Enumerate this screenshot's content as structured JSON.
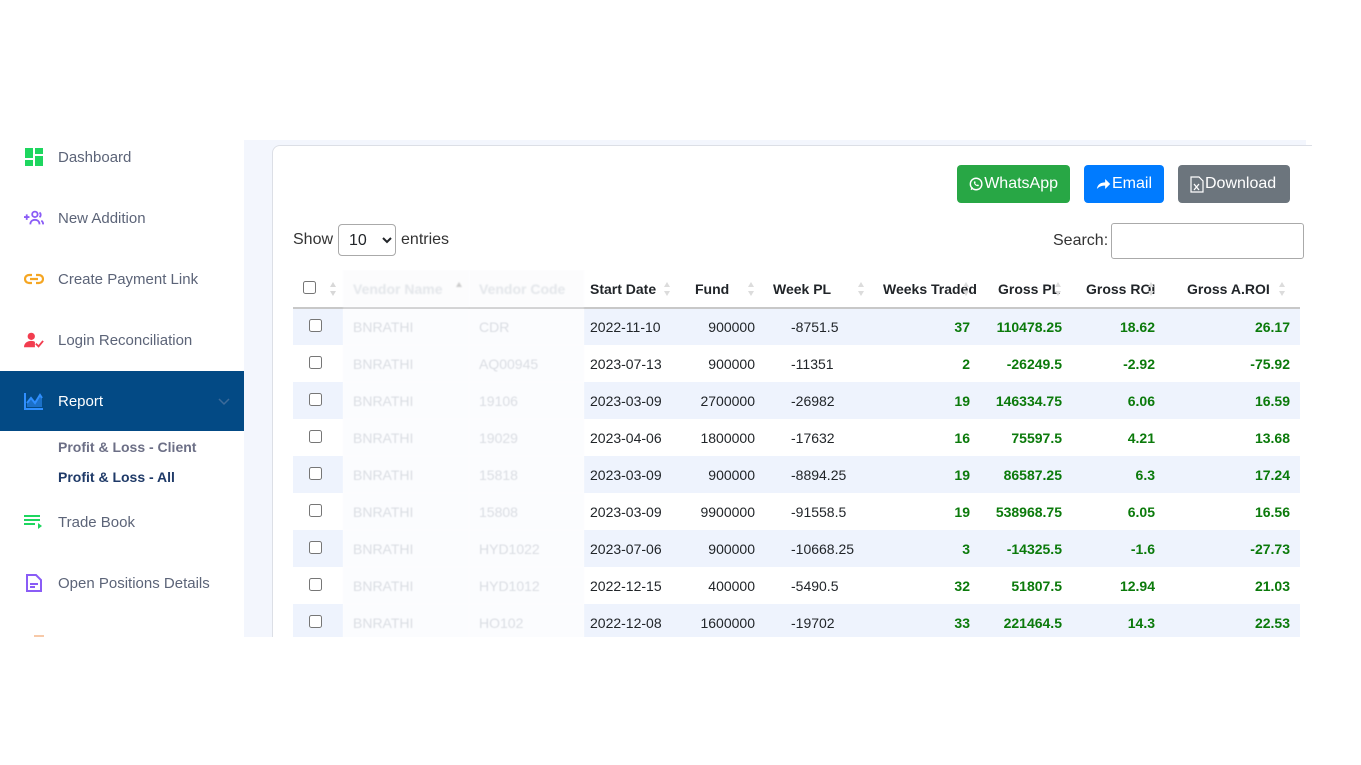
{
  "sidebar": {
    "items": [
      {
        "label": "Dashboard",
        "icon": "dashboard-icon",
        "color": "#1ed65f"
      },
      {
        "label": "New Addition",
        "icon": "add-users-icon",
        "color": "#8a5cf6"
      },
      {
        "label": "Create Payment Link",
        "icon": "link-icon",
        "color": "#f5a623"
      },
      {
        "label": "Login Reconciliation",
        "icon": "user-check-icon",
        "color": "#f23d4f"
      },
      {
        "label": "Report",
        "icon": "chart-line-icon",
        "color": "#2f8fff",
        "active": true
      },
      {
        "label": "Trade Book",
        "icon": "list-play-icon",
        "color": "#1ed65f"
      },
      {
        "label": "Open Positions Details",
        "icon": "document-icon",
        "color": "#8a5cf6"
      }
    ],
    "report_submenu": [
      {
        "label": "Profit & Loss - Client"
      },
      {
        "label": "Profit & Loss - All",
        "active": true
      }
    ]
  },
  "toolbar": {
    "whatsapp_label": "WhatsApp",
    "email_label": "Email",
    "download_label": "Download",
    "colors": {
      "whatsapp": "#28a745",
      "email": "#007bff",
      "download": "#6c757d"
    }
  },
  "length_menu": {
    "show_label": "Show",
    "entries_label": "entries",
    "selected": "10",
    "options": [
      "10"
    ]
  },
  "search": {
    "label": "Search:",
    "value": ""
  },
  "table": {
    "columns": [
      "Vendor Name",
      "Vendor Code",
      "Start Date",
      "Fund",
      "Week PL",
      "Weeks Traded",
      "Gross PL",
      "Gross ROI",
      "Gross A.ROI"
    ],
    "rows": [
      {
        "vendor_name": "BNRATHI",
        "vendor_code": "CDR",
        "start_date": "2022-11-10",
        "fund": "900000",
        "week_pl": "-8751.5",
        "weeks_traded": "37",
        "gross_pl": "110478.25",
        "gross_roi": "18.62",
        "gross_aroi": "26.17"
      },
      {
        "vendor_name": "BNRATHI",
        "vendor_code": "AQ00945",
        "start_date": "2023-07-13",
        "fund": "900000",
        "week_pl": "-11351",
        "weeks_traded": "2",
        "gross_pl": "-26249.5",
        "gross_roi": "-2.92",
        "gross_aroi": "-75.92"
      },
      {
        "vendor_name": "BNRATHI",
        "vendor_code": "19106",
        "start_date": "2023-03-09",
        "fund": "2700000",
        "week_pl": "-26982",
        "weeks_traded": "19",
        "gross_pl": "146334.75",
        "gross_roi": "6.06",
        "gross_aroi": "16.59"
      },
      {
        "vendor_name": "BNRATHI",
        "vendor_code": "19029",
        "start_date": "2023-04-06",
        "fund": "1800000",
        "week_pl": "-17632",
        "weeks_traded": "16",
        "gross_pl": "75597.5",
        "gross_roi": "4.21",
        "gross_aroi": "13.68"
      },
      {
        "vendor_name": "BNRATHI",
        "vendor_code": "15818",
        "start_date": "2023-03-09",
        "fund": "900000",
        "week_pl": "-8894.25",
        "weeks_traded": "19",
        "gross_pl": "86587.25",
        "gross_roi": "6.3",
        "gross_aroi": "17.24"
      },
      {
        "vendor_name": "BNRATHI",
        "vendor_code": "15808",
        "start_date": "2023-03-09",
        "fund": "9900000",
        "week_pl": "-91558.5",
        "weeks_traded": "19",
        "gross_pl": "538968.75",
        "gross_roi": "6.05",
        "gross_aroi": "16.56"
      },
      {
        "vendor_name": "BNRATHI",
        "vendor_code": "HYD1022",
        "start_date": "2023-07-06",
        "fund": "900000",
        "week_pl": "-10668.25",
        "weeks_traded": "3",
        "gross_pl": "-14325.5",
        "gross_roi": "-1.6",
        "gross_aroi": "-27.73"
      },
      {
        "vendor_name": "BNRATHI",
        "vendor_code": "HYD1012",
        "start_date": "2022-12-15",
        "fund": "400000",
        "week_pl": "-5490.5",
        "weeks_traded": "32",
        "gross_pl": "51807.5",
        "gross_roi": "12.94",
        "gross_aroi": "21.03"
      },
      {
        "vendor_name": "BNRATHI",
        "vendor_code": "HO102",
        "start_date": "2022-12-08",
        "fund": "1600000",
        "week_pl": "-19702",
        "weeks_traded": "33",
        "gross_pl": "221464.5",
        "gross_roi": "14.3",
        "gross_aroi": "22.53"
      }
    ]
  }
}
